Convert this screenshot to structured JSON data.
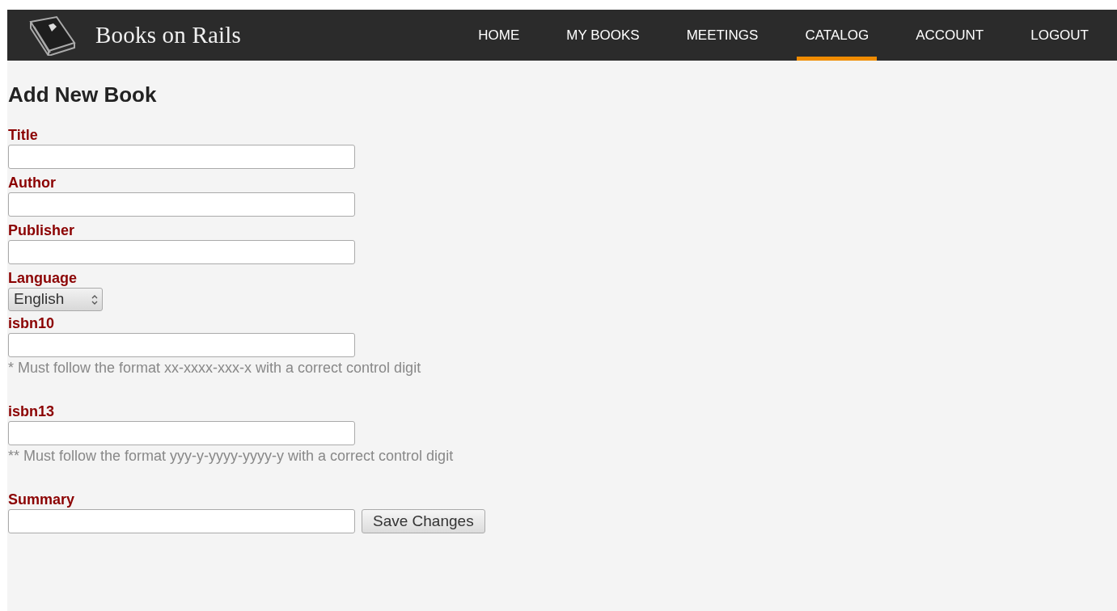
{
  "header": {
    "brand": "Books on Rails",
    "nav": [
      {
        "label": "HOME",
        "selected": false
      },
      {
        "label": "MY BOOKS",
        "selected": false
      },
      {
        "label": "MEETINGS",
        "selected": false
      },
      {
        "label": "CATALOG",
        "selected": true
      },
      {
        "label": "ACCOUNT",
        "selected": false
      },
      {
        "label": "LOGOUT",
        "selected": false
      }
    ]
  },
  "heading": "Add New Book",
  "fields": [
    {
      "label": "Title",
      "kind": "text"
    },
    {
      "label": "Author",
      "kind": "text"
    },
    {
      "label": "Publisher",
      "kind": "text"
    },
    {
      "label": "Language",
      "kind": "select",
      "value": "English"
    },
    {
      "label": "isbn10",
      "kind": "text",
      "hint": "* Must follow the format xx-xxxx-xxx-x with a correct control digit"
    },
    {
      "label": "isbn13",
      "kind": "text",
      "hint": "** Must follow the format yyy-y-yyyy-yyyy-y with a correct control digit"
    },
    {
      "label": "Summary",
      "kind": "text"
    }
  ],
  "submit": {
    "label": "Save Changes"
  }
}
